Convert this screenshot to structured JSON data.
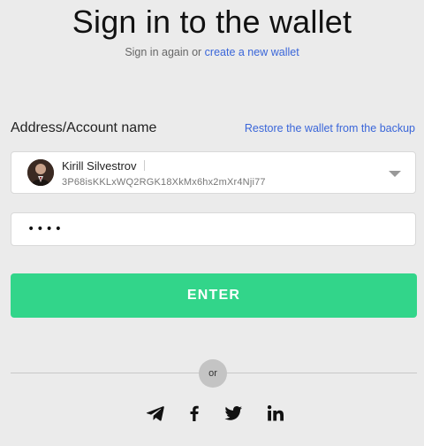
{
  "header": {
    "title": "Sign in to the wallet",
    "subtitle_prefix": "Sign in again or",
    "create_link": "create a new wallet"
  },
  "form": {
    "account_label": "Address/Account name",
    "restore_link": "Restore the wallet from the backup",
    "selected_account": {
      "name": "Kirill Silvestrov",
      "address": "3P68isKKLxWQ2RGK18XkMx6hx2mXr4Nji77"
    },
    "password_value": "••••",
    "enter_label": "ENTER"
  },
  "divider": {
    "or_label": "or"
  },
  "social": [
    "telegram-icon",
    "facebook-icon",
    "twitter-icon",
    "linkedin-icon"
  ],
  "colors": {
    "background": "#ebebeb",
    "accent_green": "#32d58a",
    "link_blue": "#3a66d9"
  }
}
